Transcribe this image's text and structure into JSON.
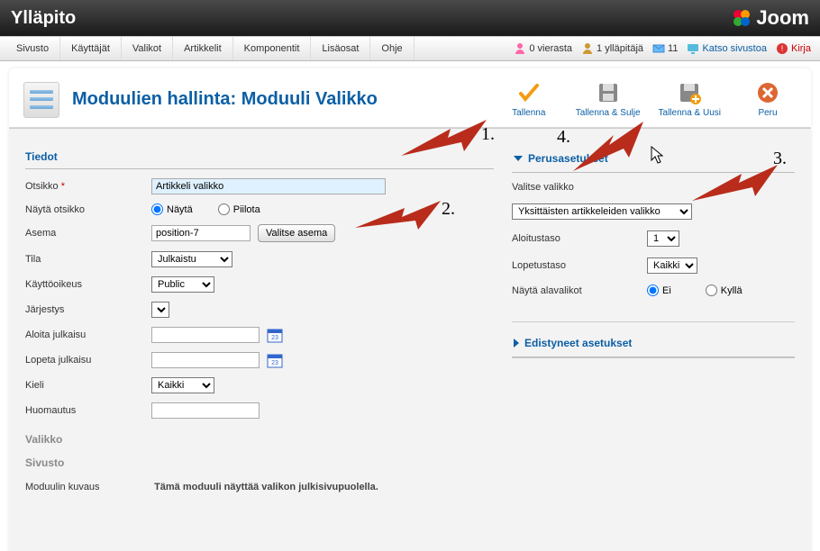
{
  "topbar": {
    "title": "Ylläpito",
    "brand": "Joom"
  },
  "menu": {
    "items": [
      "Sivusto",
      "Käyttäjät",
      "Valikot",
      "Artikkelit",
      "Komponentit",
      "Lisäosat",
      "Ohje"
    ]
  },
  "status": {
    "visitors": "0 vierasta",
    "admins": "1 ylläpitäjä",
    "messages": "11",
    "view_site": "Katso sivustoa",
    "logout": "Kirja"
  },
  "page": {
    "title": "Moduulien hallinta: Moduuli Valikko"
  },
  "toolbar": {
    "save": "Tallenna",
    "save_close": "Tallenna & Sulje",
    "save_new": "Tallenna & Uusi",
    "cancel": "Peru"
  },
  "details": {
    "legend": "Tiedot",
    "title_label": "Otsikko",
    "title_value": "Artikkeli valikko",
    "showtitle_label": "Näytä otsikko",
    "show": "Näytä",
    "hide": "Piilota",
    "position_label": "Asema",
    "position_value": "position-7",
    "position_btn": "Valitse asema",
    "status_label": "Tila",
    "status_value": "Julkaistu",
    "access_label": "Käyttöoikeus",
    "access_value": "Public",
    "ordering_label": "Järjestys",
    "start_label": "Aloita julkaisu",
    "finish_label": "Lopeta julkaisu",
    "language_label": "Kieli",
    "language_value": "Kaikki",
    "note_label": "Huomautus",
    "menu_section": "Valikko",
    "site_section": "Sivusto",
    "desc_label": "Moduulin kuvaus",
    "desc_text": "Tämä moduuli näyttää valikon julkisivupuolella."
  },
  "basic": {
    "legend": "Perusasetukset",
    "select_menu_label": "Valitse valikko",
    "select_menu_value": "Yksittäisten artikkeleiden valikko",
    "start_level_label": "Aloitustaso",
    "start_level_value": "1",
    "end_level_label": "Lopetustaso",
    "end_level_value": "Kaikki",
    "show_sub_label": "Näytä alavalikot",
    "no": "Ei",
    "yes": "Kyllä"
  },
  "advanced": {
    "legend": "Edistyneet asetukset"
  },
  "annotations": {
    "n1": "1.",
    "n2": "2.",
    "n3": "3.",
    "n4": "4."
  },
  "colors": {
    "accent": "#0b5fa5",
    "arrow": "#b92c1b"
  }
}
